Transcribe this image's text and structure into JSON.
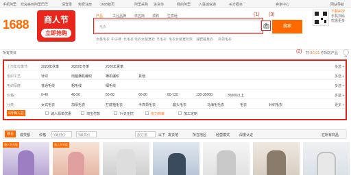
{
  "topbar": {
    "links": [
      "手机阿里",
      "欢迎来到阿里巴巴",
      "请登录",
      "免费注册",
      "1688首页",
      "阿里采购",
      "进货单",
      "我的阿里",
      "入驻诚信通",
      "买方服务",
      "卖家中心",
      "网站导航"
    ]
  },
  "logo": {
    "text": "1688"
  },
  "promo": {
    "line1": "商人节",
    "line2": "立即抢购"
  },
  "search": {
    "tabs": [
      "产品",
      "工业品牌",
      "供应商",
      "求购",
      "生意经"
    ],
    "placeholder": "毛衣",
    "button_label": "搜索",
    "hot_words": [
      "女装毛衣",
      "牛仔裤",
      "长毛衣",
      "毛衣女装宽松",
      "羊毛衫",
      "毛衣女装宽松款",
      "减肥瘦身衣",
      "高领毛衣"
    ]
  },
  "qr": {
    "line1": "下载APP",
    "line2": "手机扫码",
    "line3": "优惠更多"
  },
  "annotations": {
    "a1": "(1)",
    "a2": "(2)",
    "a3": "(3)"
  },
  "crumb": "所有类目",
  "results": {
    "prefix": "共",
    "count": "87121",
    "suffix": "件相关产品"
  },
  "filters": [
    {
      "label": "上市年份季节:",
      "options": [
        "2020年秋季",
        "2020年冬季",
        "2020年夏季"
      ],
      "more": "多选 +"
    },
    {
      "label": "毛织工艺:",
      "options": [
        "针织",
        "电脑横机编织",
        "横机编织",
        "其他"
      ],
      "more": "多选 +"
    },
    {
      "label": "毛织厚度:",
      "options": [
        "普通毛线",
        "粗毛线",
        "细毛线"
      ],
      "more": "多选 +"
    },
    {
      "label": "价格:",
      "options": [
        "0-40",
        "40-50",
        "50-60",
        "60-80",
        "80-130",
        "130-35000",
        "35000以上"
      ],
      "more": "多选 +"
    },
    {
      "label": "分类:",
      "options": [
        "女式毛衣",
        "加厚毛衣",
        "打底袖毛衣",
        "半高领毛衣",
        "套头毛衣",
        "马海毛毛衣",
        "毛衣",
        "针织毛衣"
      ],
      "more": "更多 +"
    }
  ],
  "options_row": {
    "badge": "9月嗨入驻",
    "items": [
      "诚人源单优惠",
      "淘宝付款",
      "7+天无忧",
      "实力商家",
      "加工定制"
    ]
  },
  "sort": {
    "active": "综合",
    "items": [
      "成交额",
      "价格",
      "发货地",
      "所在地区",
      "经营模式",
      "深度认证"
    ],
    "price_from": "¥最低价",
    "price_to": "¥最高价",
    "origin_label": "起订量",
    "unit_label": "以下",
    "view_all": "在所有商品"
  },
  "cards": [
    {
      "tag": "商人节大促"
    },
    {
      "tag": "商人节大促"
    },
    {
      "tag": ""
    },
    {
      "tag": ""
    },
    {
      "tag": ""
    },
    {
      "tag": ""
    },
    {
      "tag": ""
    }
  ],
  "colors": {
    "accent": "#ff6a00",
    "highlight": "#e3231c"
  }
}
